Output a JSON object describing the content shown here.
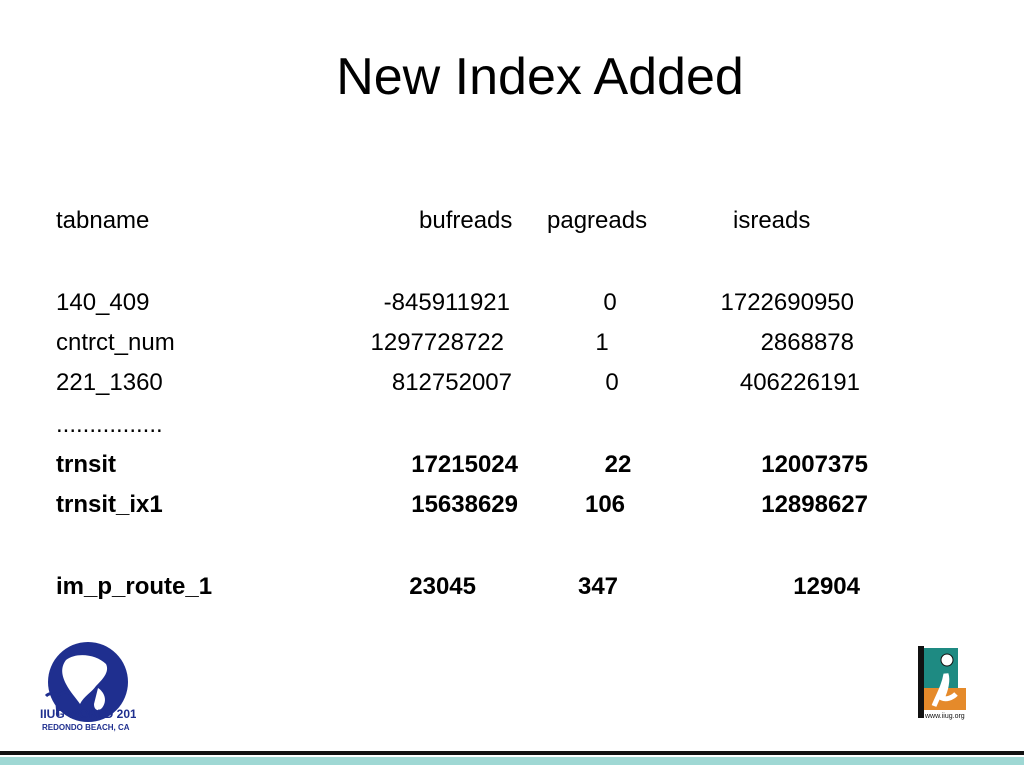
{
  "slide": {
    "title": "New Index Added",
    "headers": {
      "tabname": "tabname",
      "bufreads": "bufreads",
      "pagreads": "pagreads",
      "isreads": "isreads"
    },
    "rows": [
      {
        "tabname": " 140_409",
        "bufreads": "-845911921",
        "pagreads": "0",
        "isreads": "1722690950",
        "bold": false
      },
      {
        "tabname": "cntrct_num",
        "bufreads": "1297728722",
        "pagreads": "1",
        "isreads": "2868878",
        "bold": false
      },
      {
        "tabname": " 221_1360",
        "bufreads": "812752007",
        "pagreads": "0",
        "isreads": "406226191",
        "bold": false
      },
      {
        "tabname": "................",
        "bufreads": "",
        "pagreads": "",
        "isreads": "",
        "bold": false
      },
      {
        "tabname": "trnsit",
        "bufreads": "17215024",
        "pagreads": "22",
        "isreads": "12007375",
        "bold": true
      },
      {
        "tabname": "trnsit_ix1",
        "bufreads": "15638629",
        "pagreads": "106",
        "isreads": "12898627",
        "bold": true
      },
      {
        "tabname": "im_p_route_1",
        "bufreads": "23045",
        "pagreads": "347",
        "isreads": "12904",
        "bold": true
      }
    ],
    "logos": {
      "left_text_line1": "IIUG WORLD 2019",
      "left_text_line2": "REDONDO BEACH, CA",
      "right_text": "www.iiug.org"
    }
  },
  "colors": {
    "globe_blue": "#1f2f8f",
    "teal_bar": "#9fd8d4",
    "iiug_teal": "#1e8a82",
    "iiug_orange": "#e58a2a"
  }
}
